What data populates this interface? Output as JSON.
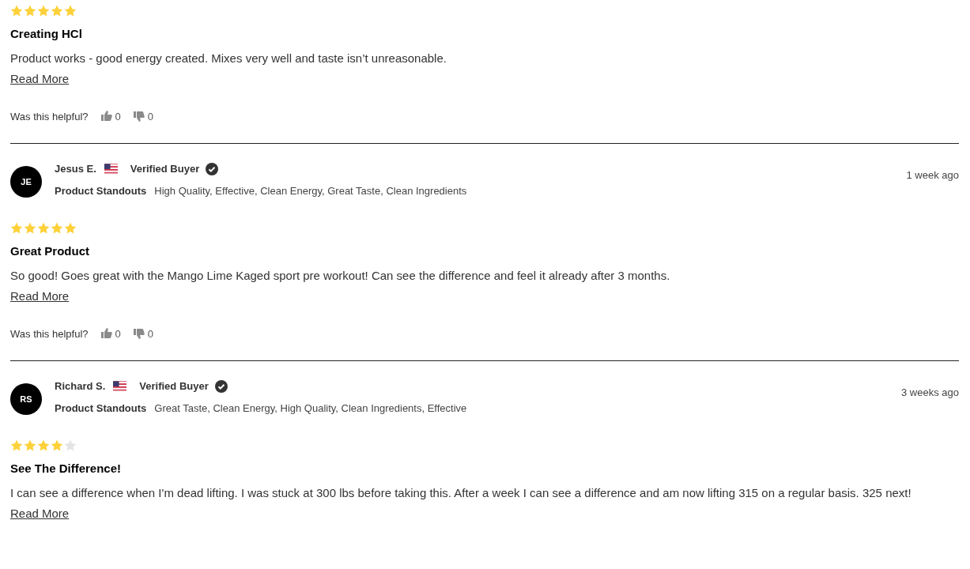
{
  "reviews": [
    {
      "stars": 5,
      "title": "Creating HCl",
      "body": "Product works - good energy created. Mixes very well and taste isn’t unreasonable.",
      "read_more": "Read More",
      "helpful_label": "Was this helpful?",
      "up_count": "0",
      "down_count": "0"
    },
    {
      "author": {
        "initials": "JE",
        "name": "Jesus E.",
        "badge": "Verified Buyer",
        "standouts_label": "Product Standouts",
        "standouts": "High Quality, Effective, Clean Energy, Great Taste, Clean Ingredients",
        "date": "1 week ago"
      },
      "stars": 5,
      "title": "Great Product",
      "body": "So good! Goes great with the Mango Lime Kaged sport pre workout! Can see the difference and feel it already after 3 months.",
      "read_more": "Read More",
      "helpful_label": "Was this helpful?",
      "up_count": "0",
      "down_count": "0"
    },
    {
      "author": {
        "initials": "RS",
        "name": "Richard S.",
        "badge": "Verified Buyer",
        "standouts_label": "Product Standouts",
        "standouts": "Great Taste, Clean Energy, High Quality, Clean Ingredients, Effective",
        "date": "3 weeks ago"
      },
      "stars": 4,
      "title": "See The Difference!",
      "body": "I can see a difference when I'm dead lifting. I was stuck at 300 lbs before taking this. After a week I can see a difference and am now lifting 315 on a regular basis. 325 next!",
      "read_more": "Read More"
    }
  ]
}
